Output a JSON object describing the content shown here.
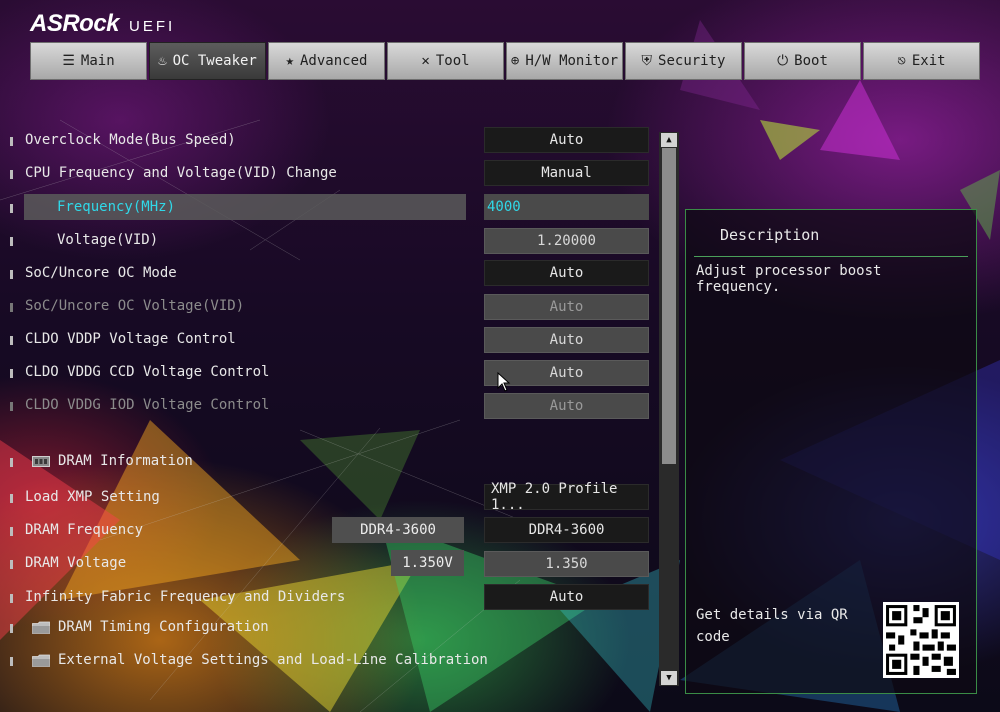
{
  "header": {
    "brand": "ASRock",
    "brand_sub": "UEFI"
  },
  "colors": {
    "accent": "#30d8e8",
    "tab_active": "#4a4a4a",
    "panel_border": "#3a8c46"
  },
  "tabs": [
    {
      "label": "Main",
      "icon": "list-icon",
      "glyph": "☰"
    },
    {
      "label": "OC Tweaker",
      "icon": "flame-icon",
      "glyph": "♨"
    },
    {
      "label": "Advanced",
      "icon": "star-icon",
      "glyph": "★"
    },
    {
      "label": "Tool",
      "icon": "tools-icon",
      "glyph": "✕"
    },
    {
      "label": "H/W Monitor",
      "icon": "globe-icon",
      "glyph": "⊕"
    },
    {
      "label": "Security",
      "icon": "shield-icon",
      "glyph": "⛨"
    },
    {
      "label": "Boot",
      "icon": "power-icon",
      "glyph": "⏻"
    },
    {
      "label": "Exit",
      "icon": "exit-icon",
      "glyph": "⎋"
    }
  ],
  "settings": {
    "overclock_mode": {
      "label": "Overclock Mode(Bus Speed)",
      "value": "Auto"
    },
    "cpu_freq_voltage_change": {
      "label": "CPU Frequency and Voltage(VID) Change",
      "value": "Manual"
    },
    "frequency": {
      "label": "Frequency(MHz)",
      "value": "4000"
    },
    "voltage_vid": {
      "label": "Voltage(VID)",
      "value": "1.20000"
    },
    "soc_uncore_oc_mode": {
      "label": "SoC/Uncore OC Mode",
      "value": "Auto"
    },
    "soc_uncore_oc_voltage": {
      "label": "SoC/Uncore OC Voltage(VID)",
      "value": "Auto"
    },
    "cldo_vddp": {
      "label": "CLDO VDDP Voltage Control",
      "value": "Auto"
    },
    "cldo_vddg_ccd": {
      "label": "CLDO VDDG CCD Voltage Control",
      "value": "Auto"
    },
    "cldo_vddg_iod": {
      "label": "CLDO VDDG IOD Voltage Control",
      "value": "Auto"
    },
    "dram_information": {
      "label": "DRAM Information"
    },
    "load_xmp": {
      "label": "Load XMP Setting",
      "value": "XMP 2.0 Profile 1..."
    },
    "dram_frequency": {
      "label": "DRAM Frequency",
      "current": "DDR4-3600",
      "value": "DDR4-3600"
    },
    "dram_voltage": {
      "label": "DRAM Voltage",
      "current": "1.350V",
      "value": "1.350"
    },
    "infinity_fabric": {
      "label": "Infinity Fabric Frequency and Dividers",
      "value": "Auto"
    },
    "dram_timing": {
      "label": "DRAM Timing Configuration"
    },
    "external_voltage": {
      "label": "External Voltage Settings and Load-Line Calibration"
    }
  },
  "description": {
    "title": "Description",
    "text": "Adjust processor boost frequency.",
    "qr_text": "Get details via QR code"
  }
}
